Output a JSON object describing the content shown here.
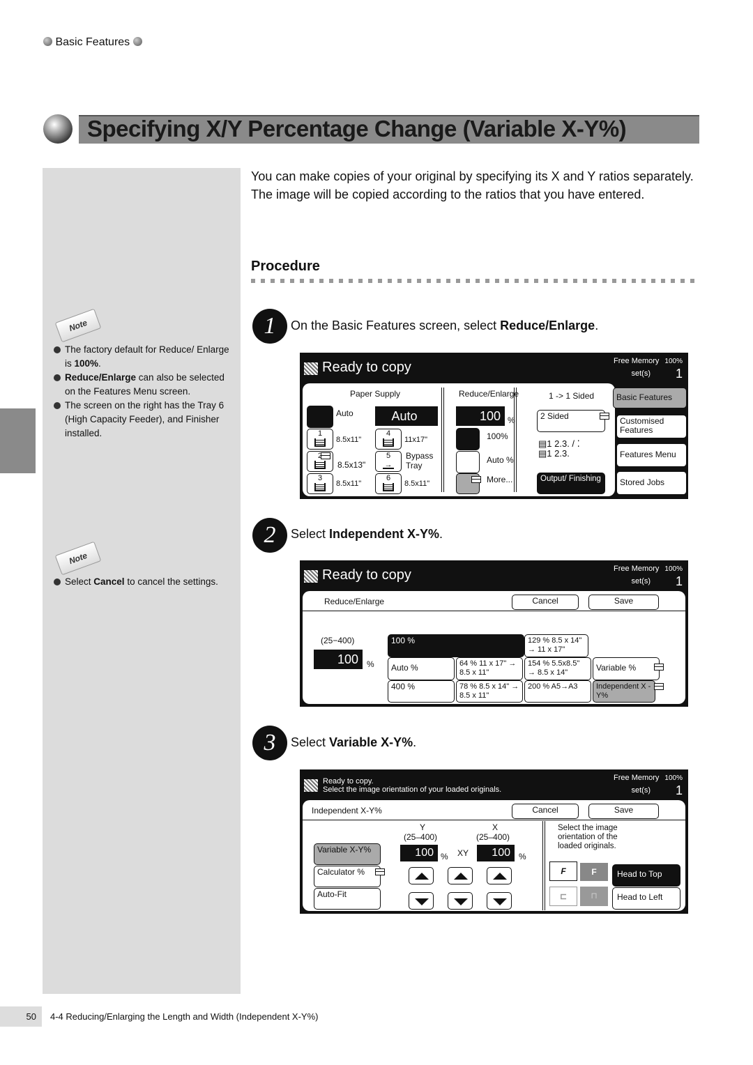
{
  "header": {
    "section": "Basic Features"
  },
  "title": "Specifying X/Y Percentage Change (Variable X-Y%)",
  "intro": "You can make copies of your original by specifying its X and Y ratios separately. The image will be copied according to the ratios that you have entered.",
  "procedure_heading": "Procedure",
  "notes": [
    {
      "icon_label": "Note",
      "items": [
        {
          "pre": "The factory default for Reduce/ Enlarge is ",
          "bold": "100%",
          "post": "."
        },
        {
          "pre": "",
          "bold": "Reduce/Enlarge",
          "post": " can also be selected on the Features Menu screen."
        },
        {
          "pre": "The screen on the right has the Tray 6 (High Capacity Feeder), and Finisher installed.",
          "bold": "",
          "post": ""
        }
      ]
    },
    {
      "icon_label": "Note",
      "items": [
        {
          "pre": "Select ",
          "bold": "Cancel",
          "post": " to cancel the settings."
        }
      ]
    }
  ],
  "steps": [
    {
      "num": "1",
      "pre": "On the Basic Features screen, select ",
      "bold": "Reduce/Enlarge",
      "post": "."
    },
    {
      "num": "2",
      "pre": "Select ",
      "bold": "Independent X-Y%",
      "post": "."
    },
    {
      "num": "3",
      "pre": "Select ",
      "bold": "Variable X-Y%",
      "post": "."
    }
  ],
  "screen1": {
    "status": "Ready to copy",
    "free_memory": "Free Memory",
    "memory_pct": "100%",
    "sets_label": "set(s)",
    "sets": "1",
    "paper_supply": "Paper Supply",
    "auto_label": "Auto",
    "auto_box": "Auto",
    "trays": [
      {
        "num": "1",
        "size": "8.5x11\""
      },
      {
        "num": "2",
        "size": "8.5x13\""
      },
      {
        "num": "3",
        "size": "8.5x11\""
      },
      {
        "num": "4",
        "size": "11x17\""
      },
      {
        "num": "5",
        "size": "Bypass Tray"
      },
      {
        "num": "6",
        "size": "8.5x11\""
      }
    ],
    "reduce_enlarge": "Reduce/Enlarge",
    "ratio": "100",
    "pct": "%",
    "opt_100": "100%",
    "opt_auto": "Auto %",
    "opt_more": "More...",
    "sided": "1 -> 1 Sided",
    "two_sided": "2 Sided",
    "output": "Output/ Finishing",
    "tabs": [
      "Basic Features",
      "Customised Features",
      "Features Menu",
      "Stored Jobs"
    ]
  },
  "screen2": {
    "status": "Ready to copy",
    "free_memory": "Free Memory",
    "memory_pct": "100%",
    "sets_label": "set(s)",
    "sets": "1",
    "subtitle": "Reduce/Enlarge",
    "cancel": "Cancel",
    "save": "Save",
    "range": "(25−400)",
    "ratio": "100",
    "pct": "%",
    "presets": {
      "p100": "100 %",
      "p129": "129 %  8.5 x 14\"  → 11 x 17\"",
      "auto": "Auto %",
      "p64": "64 %   11 x 17\"  → 8.5 x 11\"",
      "p154": "154 %  5.5x8.5\"  → 8.5 x 14\"",
      "variable": "Variable %",
      "p400": "400 %",
      "p78": "78 %   8.5 x 14\"  → 8.5 x 11\"",
      "p200": "200 %  A5→A3",
      "independent": "Independent X - Y%"
    }
  },
  "screen3": {
    "status_line1": "Ready to copy.",
    "status_line2": "Select the image orientation of your loaded originals.",
    "free_memory": "Free Memory",
    "memory_pct": "100%",
    "sets_label": "set(s)",
    "sets": "1",
    "subtitle": "Independent X-Y%",
    "cancel": "Cancel",
    "save": "Save",
    "modes": [
      "Variable X-Y%",
      "Calculator %",
      "Auto-Fit"
    ],
    "y_label": "Y",
    "x_label": "X",
    "y_range": "(25–400)",
    "x_range": "(25–400)",
    "y_value": "100",
    "x_value": "100",
    "pct": "%",
    "xy": "XY",
    "orientation_text": "Select the image orientation of the loaded originals.",
    "head_top": "Head to Top",
    "head_left": "Head to Left"
  },
  "footer": {
    "page": "50",
    "section": "4-4  Reducing/Enlarging the Length and Width (Independent X-Y%)"
  }
}
